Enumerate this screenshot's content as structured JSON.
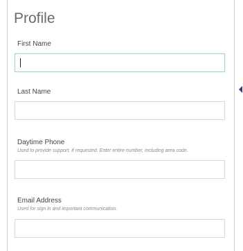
{
  "profile": {
    "title": "Profile",
    "first_name": {
      "label": "First Name",
      "value": ""
    },
    "last_name": {
      "label": "Last Name",
      "value": ""
    },
    "daytime_phone": {
      "label": "Daytime Phone",
      "hint": "Used to provide support, if requested. Enter entire number, including area code.",
      "value": ""
    },
    "email_address": {
      "label": "Email Address",
      "hint": "Used for sign in and important communication.",
      "value": ""
    }
  },
  "handle_icon": "collapse-arrow-left",
  "colors": {
    "focus_border": "#9fd3de",
    "handle": "#2c3e7a"
  }
}
